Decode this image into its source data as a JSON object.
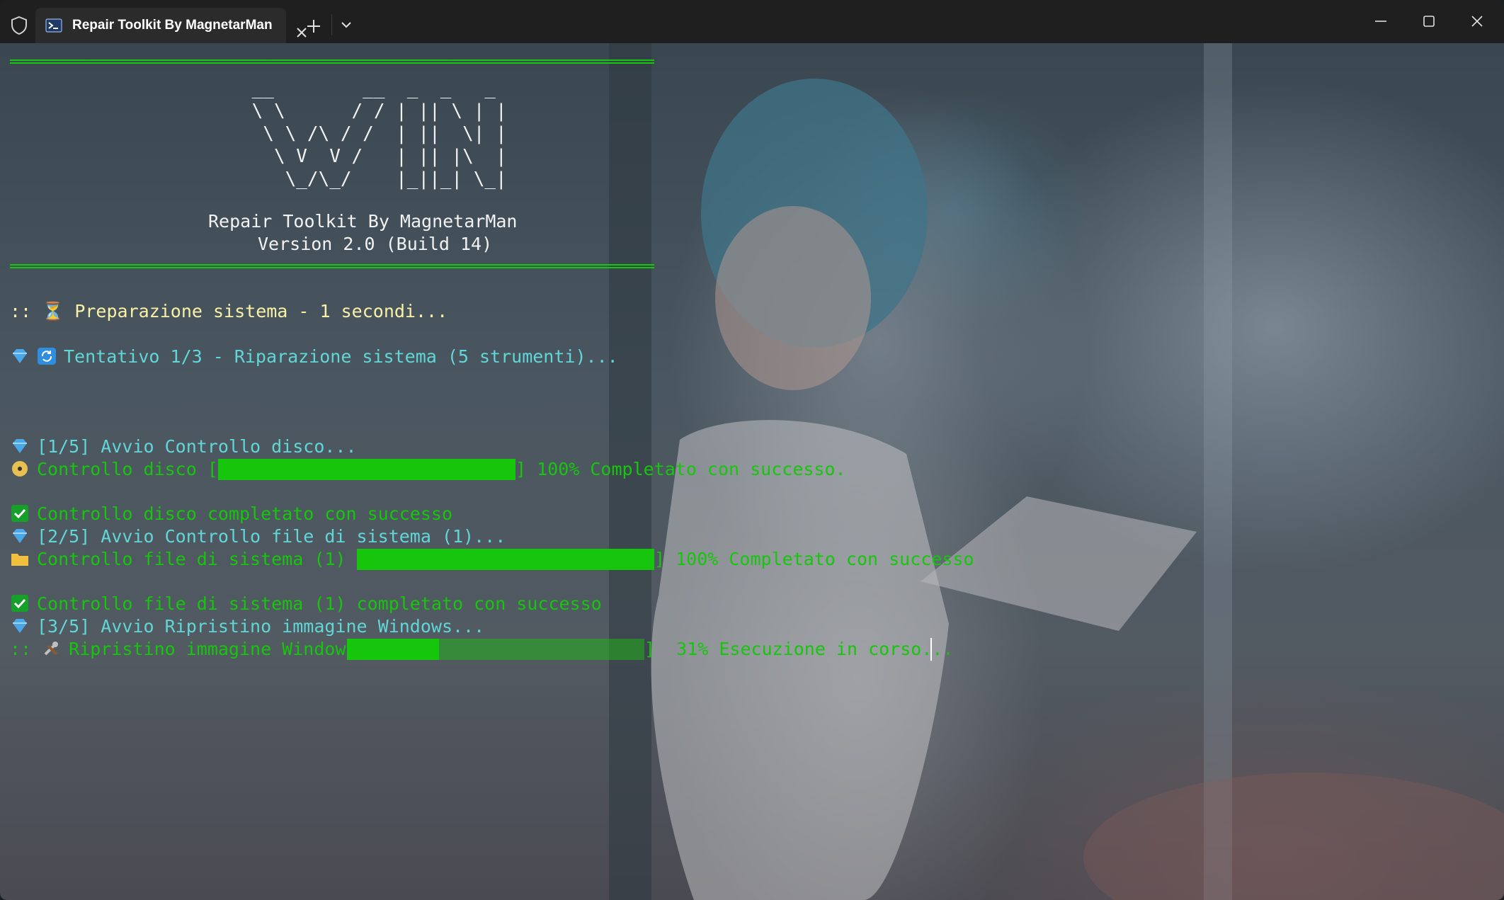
{
  "window": {
    "tab_title": "Repair Toolkit By MagnetarMan",
    "new_tab_icon": "plus-icon",
    "dropdown_icon": "chevron-down-icon",
    "minimize_icon": "minimize-icon",
    "maximize_icon": "maximize-icon",
    "close_icon": "close-icon"
  },
  "banner": {
    "ascii_art": " __        __  _  _   _ \n \\ \\      / / | || \\ | |\n  \\ \\ /\\ / /  | ||  \\| |\n   \\ V  V /   | || |\\  |\n    \\_/\\_/    |_||_| \\_|",
    "title": "Repair Toolkit By MagnetarMan",
    "version": "Version 2.0 (Build 14)"
  },
  "colors": {
    "green": "#16c60c",
    "yellow": "#f9f1a5",
    "cyan": "#61d6d6",
    "white": "#f2f2f2"
  },
  "lines": {
    "prep": ":: ⏳ Preparazione sistema - 1 secondi...",
    "attempt": "Tentativo 1/3 - Riparazione sistema (5 strumenti)...",
    "step1_start": "[1/5] Avvio Controllo disco...",
    "step1_bar_label": "Controllo disco [",
    "step1_bar_end": "] 100% Completato con successo.",
    "step1_done": "Controllo disco completato con successo",
    "step2_start": "[2/5] Avvio Controllo file di sistema (1)...",
    "step2_bar_label": "Controllo file di sistema (1) [",
    "step2_bar_end": "] 100% Completato con successo",
    "step2_done": "Controllo file di sistema (1) completato con successo",
    "step3_start": "[3/5] Avvio Ripristino immagine Windows...",
    "step3_bar_label": "Ripristino immagine Windows [",
    "step3_bar_end": "]  31% Esecuzione in corso..."
  },
  "progress": {
    "step1": 1.0,
    "step2": 1.0,
    "step3": 0.31
  },
  "icons": {
    "prep": "hourglass-icon",
    "attempt": "refresh-icon",
    "step": "diamond-icon",
    "disk": "disc-icon",
    "folder": "folder-icon",
    "tools": "tools-icon",
    "check": "check-icon"
  }
}
